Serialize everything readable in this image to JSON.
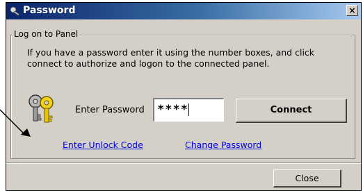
{
  "window": {
    "title": "Password",
    "close_glyph": "×"
  },
  "group": {
    "legend": "Log on to Panel",
    "description": "If you have a password enter it using the number boxes, and click connect to authorize and logon to the connected panel."
  },
  "form": {
    "password_label": "Enter Password",
    "password_value": "****",
    "connect_label": "Connect"
  },
  "links": {
    "unlock": "Enter Unlock Code",
    "change": "Change Password"
  },
  "footer": {
    "close_label": "Close"
  },
  "icons": {
    "title": "key-icon",
    "keys": "keys-icon",
    "arrow": "pointer-arrow"
  },
  "colors": {
    "title_start": "#0a246a",
    "title_end": "#a6caf0",
    "window_bg": "#d4d0c8",
    "link": "#0000ee"
  }
}
